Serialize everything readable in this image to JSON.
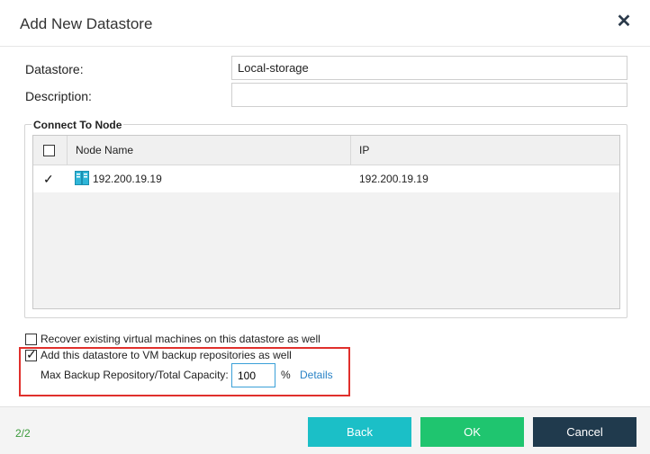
{
  "dialog": {
    "title": "Add New Datastore",
    "close_icon": "close-icon"
  },
  "form": {
    "datastore_label": "Datastore:",
    "datastore_value": "Local-storage",
    "description_label": "Description:",
    "description_value": ""
  },
  "connect": {
    "legend": "Connect To Node",
    "columns": [
      "Node Name",
      "IP"
    ],
    "rows": [
      {
        "checked": true,
        "node_icon": "server-icon",
        "node_name": "192.200.19.19",
        "ip": "192.200.19.19"
      }
    ]
  },
  "options": {
    "recover_label": "Recover existing virtual machines on this datastore as well",
    "recover_checked": false,
    "add_repo_label": "Add this datastore to VM backup repositories as well",
    "add_repo_checked": true,
    "capacity_label": "Max Backup Repository/Total Capacity:",
    "capacity_value": "100",
    "capacity_unit": "%",
    "details_link": "Details"
  },
  "footer": {
    "step": "2/2",
    "back_label": "Back",
    "ok_label": "OK",
    "cancel_label": "Cancel"
  },
  "colors": {
    "back": "#1bbfc7",
    "ok": "#1fc56f",
    "cancel": "#203a4d",
    "highlight": "#e0302c",
    "link": "#2a83c6",
    "step": "#3a9a3a"
  }
}
